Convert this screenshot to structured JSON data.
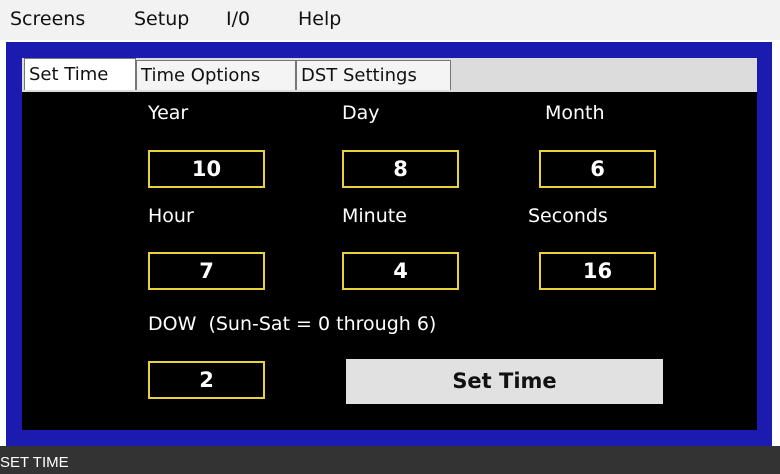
{
  "menu": {
    "items": [
      "Screens",
      "Setup",
      "I/0",
      "Help"
    ]
  },
  "tabs": [
    "Set Time",
    "Time Options",
    "DST Settings"
  ],
  "active_tab": "Set Time",
  "fields": {
    "year": {
      "label": "Year",
      "value": "10"
    },
    "day": {
      "label": "Day",
      "value": "8"
    },
    "month": {
      "label": "Month",
      "value": "6"
    },
    "hour": {
      "label": "Hour",
      "value": "7"
    },
    "minute": {
      "label": "Minute",
      "value": "4"
    },
    "seconds": {
      "label": "Seconds",
      "value": "16"
    },
    "dow": {
      "label": "DOW  (Sun-Sat = 0 through 6)",
      "value": "2"
    }
  },
  "set_time_button": "Set Time",
  "status": "SET TIME",
  "colors": {
    "frame": "#1b1bb0",
    "panel": "#000000",
    "field_border": "#ead33a",
    "status_bar": "#333333"
  }
}
